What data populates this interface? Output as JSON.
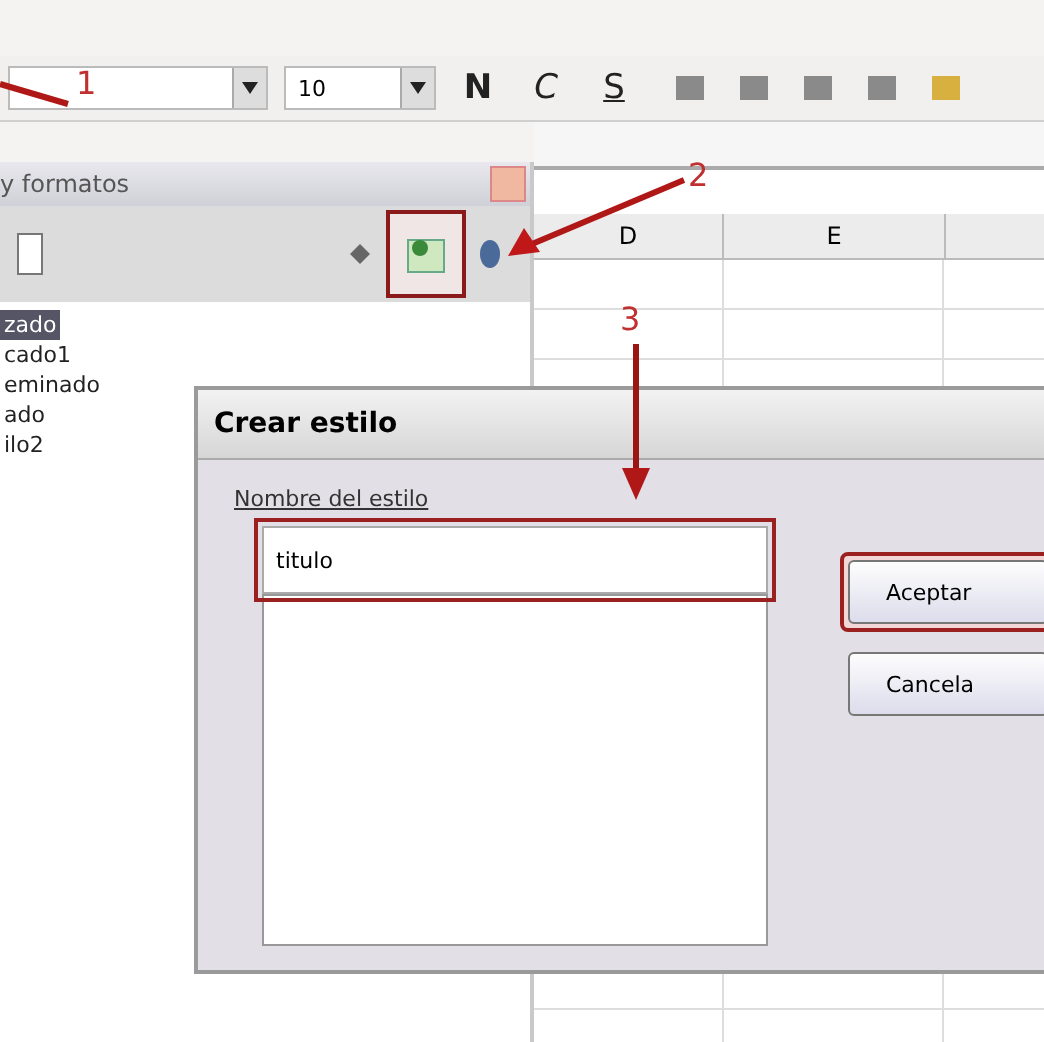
{
  "toolbar": {
    "font_size": "10",
    "format_buttons": [
      "N",
      "C",
      "S"
    ]
  },
  "styles_panel": {
    "title": "y formatos",
    "styles": [
      {
        "label": "zado",
        "selected": true
      },
      {
        "label": "cado1",
        "selected": false
      },
      {
        "label": "eminado",
        "selected": false
      },
      {
        "label": "ado",
        "selected": false
      },
      {
        "label": "ilo2",
        "selected": false
      }
    ]
  },
  "sheet": {
    "columns": [
      "D",
      "E"
    ]
  },
  "annotations": [
    {
      "label": "1"
    },
    {
      "label": "2"
    },
    {
      "label": "3"
    }
  ],
  "dialog": {
    "title": "Crear estilo",
    "field_label": "Nombre del estilo",
    "style_name": "titulo",
    "buttons": [
      {
        "label": "Aceptar",
        "annotated": true
      },
      {
        "label": "Cancela",
        "annotated": false
      }
    ]
  }
}
